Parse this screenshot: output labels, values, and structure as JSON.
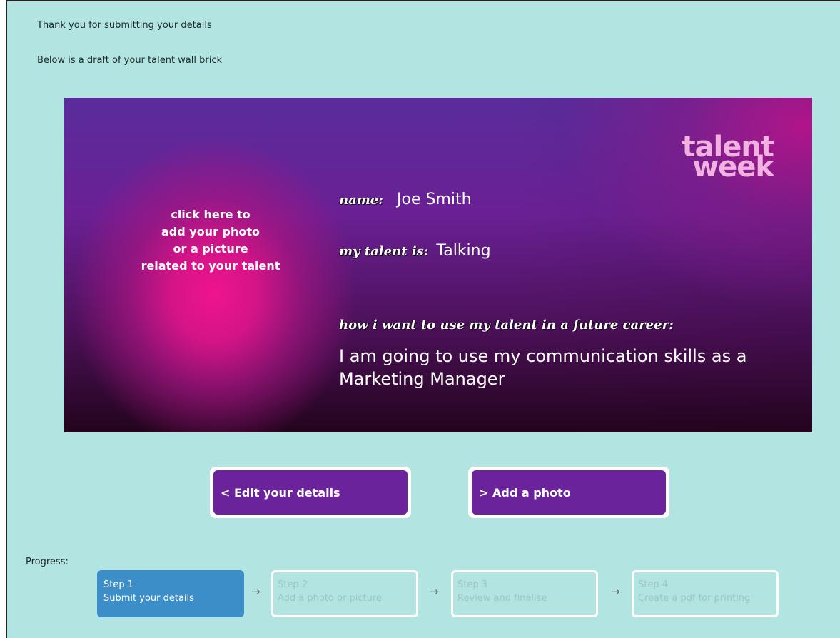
{
  "intro": {
    "line1": "Thank you for submitting your details",
    "line2": "Below is a draft of your talent wall brick"
  },
  "brick": {
    "logo_line1": "talent",
    "logo_line2": "week",
    "photo_cta": [
      "click here to",
      "add your photo",
      "or a picture",
      "related to your talent"
    ],
    "name_label": "name:",
    "name_value": "Joe Smith",
    "talent_label": "my talent is:",
    "talent_value": "Talking",
    "career_label": "how i want to use my talent in a future career:",
    "career_value": "I am going to use my communication skills as a Marketing Manager"
  },
  "buttons": {
    "edit": "< Edit your details",
    "add_photo": "> Add a photo"
  },
  "progress": {
    "label": "Progress:",
    "arrow": "→",
    "steps": [
      {
        "title": "Step 1",
        "desc": "Submit your details"
      },
      {
        "title": "Step 2",
        "desc": "Add a photo or picture"
      },
      {
        "title": "Step 3",
        "desc": "Review and finalise"
      },
      {
        "title": "Step 4",
        "desc": "Create a pdf for printing"
      }
    ],
    "active_step": 1
  },
  "colors": {
    "background": "#b2e4e1",
    "button": "#6a239a",
    "active_step": "#3c8ec8"
  }
}
